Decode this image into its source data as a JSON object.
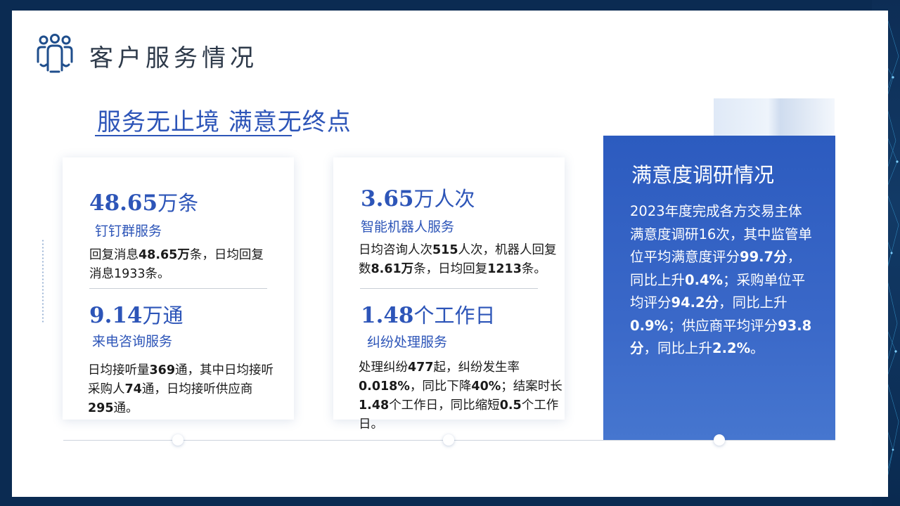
{
  "page": {
    "title": "客户服务情况",
    "subtitle": "服务无止境  满意无终点",
    "header_icon": "users-icon"
  },
  "cards": [
    {
      "top_value": "48.65",
      "top_unit": "万条",
      "top_label": "钉钉群服务",
      "top_desc": [
        {
          "t": "回复消息",
          "b": false
        },
        {
          "t": "48.65万",
          "b": true
        },
        {
          "t": "条，日均回复消息1933条。",
          "b": false
        }
      ],
      "bottom_value": "9.14",
      "bottom_unit": "万通",
      "bottom_label": "来电咨询服务",
      "bottom_desc": [
        {
          "t": "日均接听量",
          "b": false
        },
        {
          "t": "369",
          "b": true
        },
        {
          "t": "通，其中日均接听采购人",
          "b": false
        },
        {
          "t": "74",
          "b": true
        },
        {
          "t": "通，日均接听供应商",
          "b": false
        },
        {
          "t": "295",
          "b": true
        },
        {
          "t": "通。",
          "b": false
        }
      ]
    },
    {
      "top_value": "3.65",
      "top_unit": "万人次",
      "top_label": "智能机器人服务",
      "top_desc": [
        {
          "t": "日均咨询人次",
          "b": false
        },
        {
          "t": "515",
          "b": true
        },
        {
          "t": "人次，机器人回复数",
          "b": false
        },
        {
          "t": "8.61万",
          "b": true
        },
        {
          "t": "条，日均回复",
          "b": false
        },
        {
          "t": "1213",
          "b": true
        },
        {
          "t": "条。",
          "b": false
        }
      ],
      "bottom_value": "1.48",
      "bottom_unit": "个工作日",
      "bottom_label": "纠纷处理服务",
      "bottom_desc": [
        {
          "t": "处理纠纷",
          "b": false
        },
        {
          "t": "477",
          "b": true
        },
        {
          "t": "起，纠纷发生率",
          "b": false
        },
        {
          "t": "0.018%",
          "b": true
        },
        {
          "t": "，同比下降",
          "b": false
        },
        {
          "t": "40%",
          "b": true
        },
        {
          "t": "；结案时长",
          "b": false
        },
        {
          "t": "1.48",
          "b": true
        },
        {
          "t": "个工作日，同比缩短",
          "b": false
        },
        {
          "t": "0.5",
          "b": true
        },
        {
          "t": "个工作日。",
          "b": false
        }
      ]
    }
  ],
  "survey": {
    "title": "满意度调研情况",
    "body": [
      {
        "t": "2023年度完成各方交易主体满意度调研16次，其中监管单位平均满意度评分",
        "b": false
      },
      {
        "t": "99.7分",
        "b": true
      },
      {
        "t": "，同比上升",
        "b": false
      },
      {
        "t": "0.4%",
        "b": true
      },
      {
        "t": "；采购单位平均评分",
        "b": false
      },
      {
        "t": "94.2分",
        "b": true
      },
      {
        "t": "，同比上升",
        "b": false
      },
      {
        "t": "0.9%",
        "b": true
      },
      {
        "t": "；供应商平均评分",
        "b": false
      },
      {
        "t": "93.8分",
        "b": true
      },
      {
        "t": "，同比上升",
        "b": false
      },
      {
        "t": "2.2%",
        "b": true
      },
      {
        "t": "。",
        "b": false
      }
    ]
  },
  "timeline": {
    "active_node": 2
  },
  "colors": {
    "accent": "#2d55b8",
    "panel": "#2c5bbf",
    "frame": "#0b2b52"
  }
}
